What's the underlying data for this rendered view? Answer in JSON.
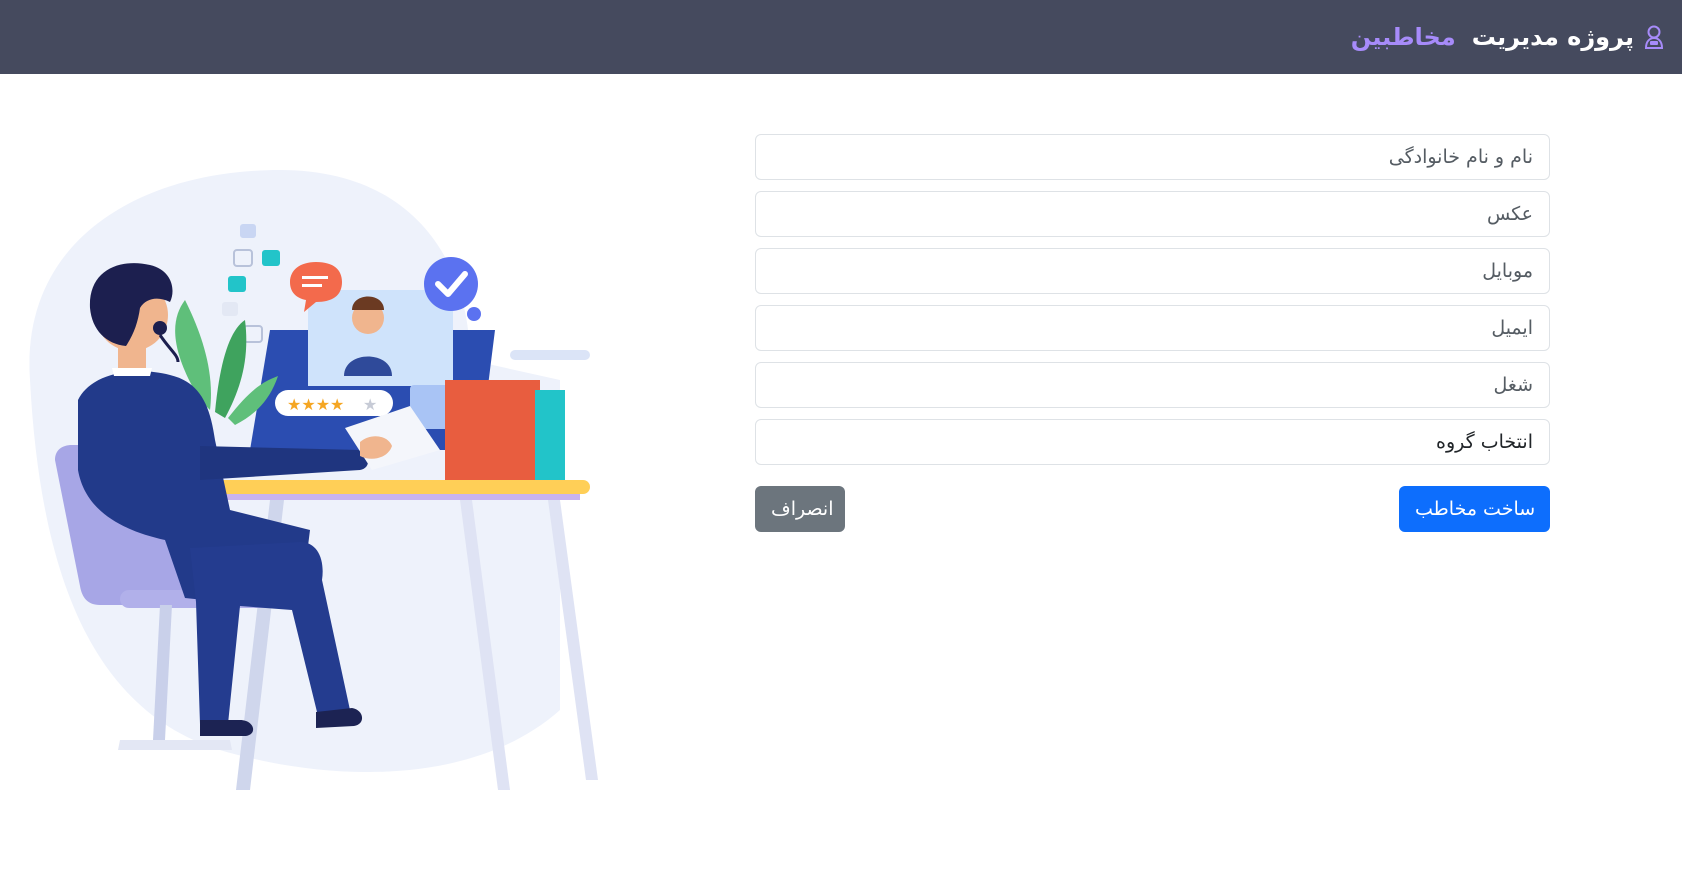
{
  "header": {
    "title": "پروژه مدیریت",
    "title_accent": "مخاطبین",
    "icon": "user-id-icon"
  },
  "form": {
    "fullname": {
      "placeholder": "نام و نام خانوادگی",
      "value": ""
    },
    "photo": {
      "placeholder": "عکس",
      "value": ""
    },
    "mobile": {
      "placeholder": "موبایل",
      "value": ""
    },
    "email": {
      "placeholder": "ایمیل",
      "value": ""
    },
    "job": {
      "placeholder": "شغل",
      "value": ""
    },
    "group": {
      "selected": "انتخاب گروه"
    }
  },
  "buttons": {
    "create_label": "ساخت مخاطب",
    "cancel_label": "انصراف"
  },
  "colors": {
    "navbar": "#454a5e",
    "accent": "#a78bfa",
    "primary": "#0d6efd",
    "secondary": "#6c757d"
  }
}
